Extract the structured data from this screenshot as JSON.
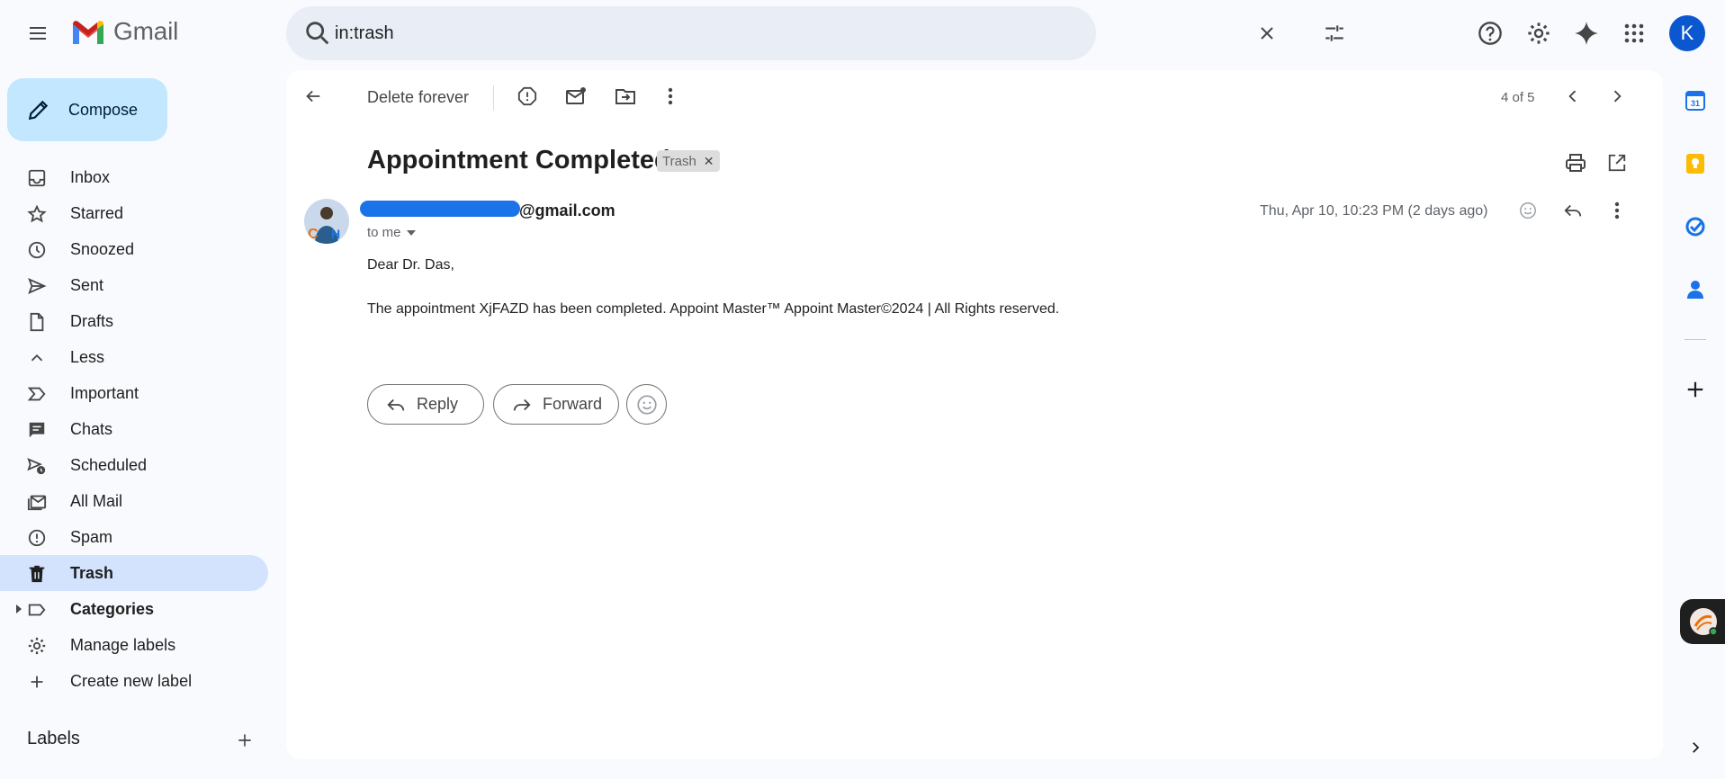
{
  "app": {
    "name": "Gmail"
  },
  "search": {
    "query": "in:trash"
  },
  "user": {
    "initial": "K"
  },
  "compose": {
    "label": "Compose"
  },
  "nav": [
    {
      "label": "Inbox",
      "icon": "inbox-icon"
    },
    {
      "label": "Starred",
      "icon": "star-icon"
    },
    {
      "label": "Snoozed",
      "icon": "clock-icon"
    },
    {
      "label": "Sent",
      "icon": "send-icon"
    },
    {
      "label": "Drafts",
      "icon": "draft-icon"
    },
    {
      "label": "Less",
      "icon": "chevron-up-icon"
    },
    {
      "label": "Important",
      "icon": "important-icon"
    },
    {
      "label": "Chats",
      "icon": "chat-icon"
    },
    {
      "label": "Scheduled",
      "icon": "scheduled-icon"
    },
    {
      "label": "All Mail",
      "icon": "all-mail-icon"
    },
    {
      "label": "Spam",
      "icon": "spam-icon"
    },
    {
      "label": "Trash",
      "icon": "trash-icon",
      "active": true
    },
    {
      "label": "Categories",
      "icon": "label-icon",
      "bold": true
    },
    {
      "label": "Manage labels",
      "icon": "gear-icon"
    },
    {
      "label": "Create new label",
      "icon": "plus-icon"
    }
  ],
  "labels": {
    "heading": "Labels"
  },
  "toolbar": {
    "delete_forever": "Delete forever",
    "pager": "4 of 5"
  },
  "email": {
    "subject": "Appointment Completed",
    "chip": "Trash",
    "sender_email": "@gmail.com",
    "to": "to me",
    "date": "Thu, Apr 10, 10:23 PM (2 days ago)",
    "greeting": "Dear Dr. Das,",
    "body": "The appointment XjFAZD has been completed. Appoint Master™ Appoint Master©2024 | All Rights reserved."
  },
  "actions": {
    "reply": "Reply",
    "forward": "Forward"
  },
  "colors": {
    "accent": "#0b57d0",
    "compose_bg": "#c2e7ff",
    "active_nav": "#d3e3fd",
    "redaction": "#1a73e8"
  }
}
